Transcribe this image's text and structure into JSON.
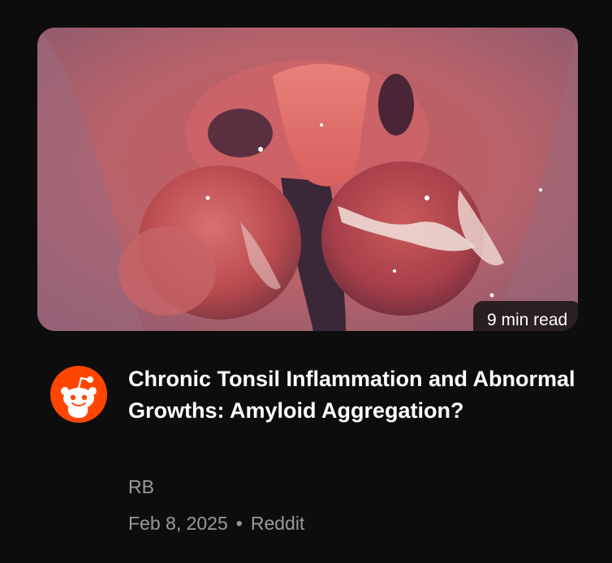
{
  "article": {
    "thumbnail_icon": "throat-photo",
    "read_time": "9 min read",
    "title": "Chronic Tonsil Inflammation and Abnormal Growths: Amyloid Aggregation?",
    "author": "RB",
    "date": "Feb 8, 2025",
    "separator": "•",
    "source": "Reddit",
    "source_icon": "reddit-logo-icon"
  },
  "colors": {
    "background": "#0d0d0d",
    "reddit_orange": "#ff4500",
    "meta_text": "#9a9a9a",
    "title_text": "#ffffff"
  }
}
